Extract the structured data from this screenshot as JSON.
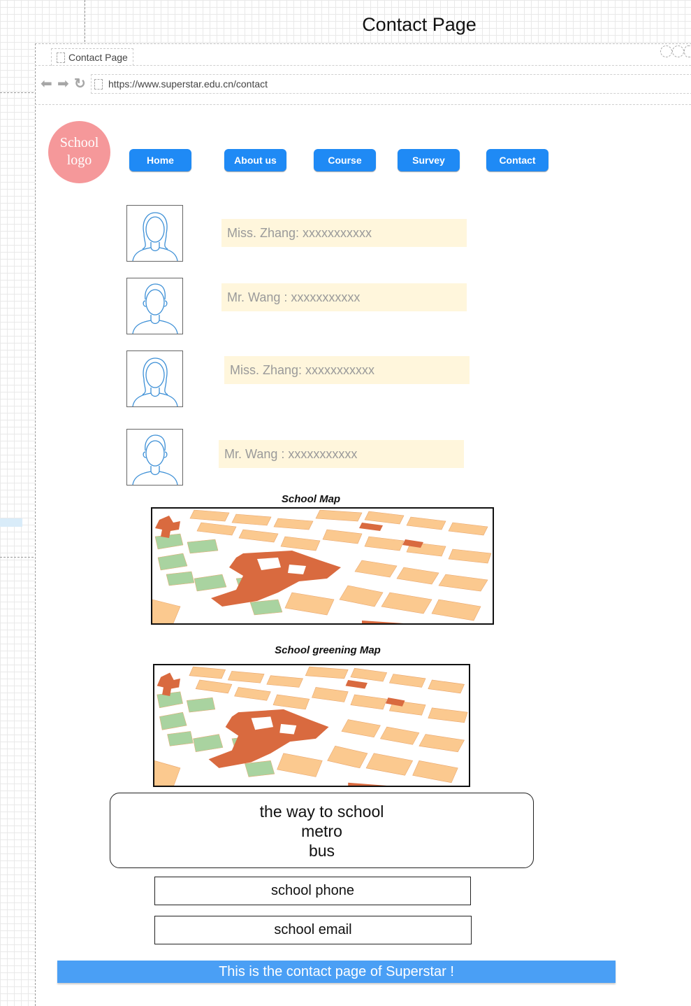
{
  "page_title": "Contact Page",
  "browser": {
    "tab_title": "Contact Page",
    "url": "https://www.superstar.edu.cn/contact"
  },
  "logo_text": "School logo",
  "nav": [
    "Home",
    "About us",
    "Course",
    "Survey",
    "Contact"
  ],
  "contacts": [
    {
      "text": "Miss. Zhang: xxxxxxxxxxx"
    },
    {
      "text": "Mr. Wang : xxxxxxxxxxx"
    },
    {
      "text": "Miss. Zhang: xxxxxxxxxxx"
    },
    {
      "text": "Mr. Wang : xxxxxxxxxxx"
    }
  ],
  "maps": {
    "school_map_caption": "School Map",
    "greening_map_caption": "School  greening Map"
  },
  "way": {
    "line1": "the way to school",
    "line2": "metro",
    "line3": "bus"
  },
  "school_phone": "school phone",
  "school_email": "school email",
  "footer": "This is the contact page of Superstar !",
  "colors": {
    "nav_button": "#1f8af5",
    "logo": "#f5989a",
    "contact_bg": "#fff6dc",
    "footer": "#4a9ff5"
  }
}
